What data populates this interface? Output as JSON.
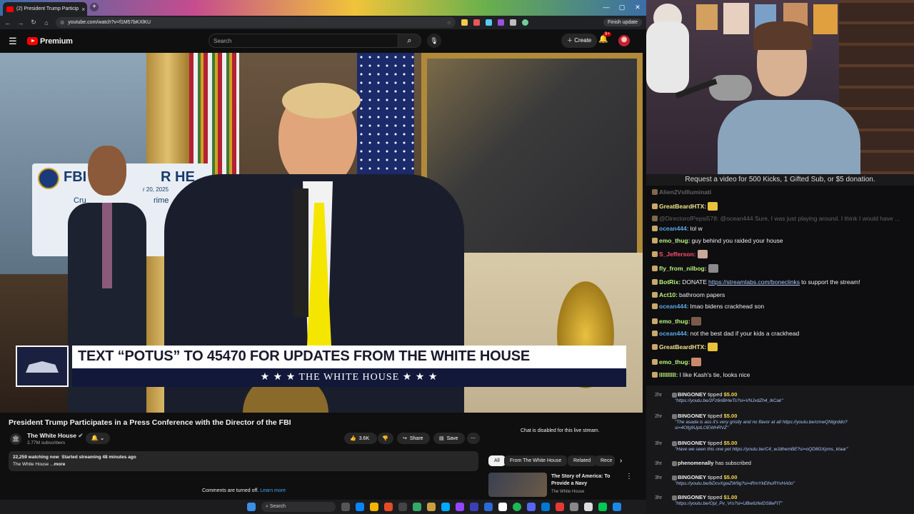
{
  "browser": {
    "tab_title": "(2) President Trump Particip",
    "url": "youtube.com/watch?v=f1M57bKXlKU",
    "finish_update": "Finish update"
  },
  "youtube": {
    "brand": "Premium",
    "search_placeholder": "Search",
    "create_label": "Create",
    "notif_count": "9+"
  },
  "video": {
    "lower_third_main": "TEXT “POTUS” TO 45470 FOR UPDATES FROM THE WHITE HOUSE",
    "lower_third_sub": "★ ★ ★  THE WHITE HOUSE  ★ ★ ★",
    "banner_left": "FBI",
    "banner_right": "R HE",
    "banner_date": "r 20, 2025",
    "banner_line2": "Cru",
    "banner_line2b": "rime",
    "title": "President Trump Participates in a Press Conference with the Director of the FBI"
  },
  "channel": {
    "name": "The White House",
    "subs": "2.77M subscribers"
  },
  "actions": {
    "likes": "3.6K",
    "share": "Share",
    "save": "Save"
  },
  "description": {
    "watching": "22,259 watching now",
    "started": "Started streaming 48 minutes ago",
    "line2": "The White House ...",
    "more": "more"
  },
  "comments": {
    "off": "Comments are turned off.",
    "learn": "Learn more"
  },
  "sidebar": {
    "chat_disabled": "Chat is disabled for this live stream.",
    "chips": [
      "All",
      "From The White House",
      "Related",
      "Rece"
    ],
    "rec_title": "The Story of America: To Provide a Navy",
    "rec_channel": "The White House"
  },
  "stream": {
    "banner": "Request a video for 500 Kicks, 1 Gifted Sub, or $5 donation.",
    "chat": [
      {
        "user": "Alien2VsIlluminati",
        "text": "",
        "color": "#9a9a9a"
      },
      {
        "user": "GreatBeardHTX:",
        "text": "",
        "color": "#f0e68c",
        "emote": "#e8c23a"
      },
      {
        "user": "",
        "text": "@DirectorofPepsi578: @ocean444 Sure, I was just playing around. I think I would have ...",
        "color": "#9a9a9a"
      },
      {
        "user": "ocean444:",
        "text": "lol w",
        "color": "#5aa9e6"
      },
      {
        "user": "emo_thug:",
        "text": "guy behind you raided your house",
        "color": "#b9f27c"
      },
      {
        "user": "S_Jefferson:",
        "text": "",
        "color": "#ff4f6d",
        "emote": "#c9a89a"
      },
      {
        "user": "fly_from_nilbog:",
        "text": "",
        "color": "#b9f27c",
        "emote": "#8a8a8a"
      },
      {
        "user": "BotRix:",
        "text": "DONATE",
        "link": "https://streamlabs.com/boneclinks",
        "after": "to support the stream!",
        "color": "#b9f27c"
      },
      {
        "user": "Act10:",
        "text": "bathroom papers",
        "color": "#b9f27c"
      },
      {
        "user": "ocean444:",
        "text": "lmao bidens crackhead son",
        "color": "#5aa9e6"
      },
      {
        "user": "emo_thug:",
        "text": "",
        "color": "#b9f27c",
        "emote": "#7a5a4a"
      },
      {
        "user": "ocean444:",
        "text": "not the best dad if your kids a crackhead",
        "color": "#5aa9e6"
      },
      {
        "user": "GreatBeardHTX:",
        "text": "",
        "color": "#f0e68c",
        "emote": "#e8c23a"
      },
      {
        "user": "emo_thug:",
        "text": "",
        "color": "#b9f27c",
        "emote": "#c98a6a"
      },
      {
        "user": "llllllllll:",
        "text": "I like Kash's tie, looks nice",
        "color": "#b9f27c"
      }
    ],
    "tips": [
      {
        "time": "2hr",
        "name": "BINGONEY",
        "action": "tipped",
        "amount": "$5.00",
        "msg": "\"https://youtu.be/2Fz6nBHwTs?si=VNJvdZh4_lkCak\""
      },
      {
        "time": "2hr",
        "name": "BINGONEY",
        "action": "tipped",
        "amount": "$5.00",
        "msg": "\"The asada is ass it's very gristly and no flavor at all https://youtu.be/cmwQNlgrddo?",
        "msg2": "si=4Ofg9UptLOEWHRVZ\""
      },
      {
        "time": "3hr",
        "name": "BINGONEY",
        "action": "tipped",
        "amount": "$5.00",
        "msg": "\"Have we seen this one yet https://youtu.be/C4_wJdhemBE?si=oQD8GXpms_ktaar\""
      },
      {
        "time": "3hr",
        "name": "phenomenally",
        "action": "has subscribed",
        "amount": "",
        "msg": ""
      },
      {
        "time": "3hr",
        "name": "BINGONEY",
        "action": "tipped",
        "amount": "$5.00",
        "msg": "\"https://youtu.be/bDcvXgwZW9g?si=iRmYkElhuRYvHA0o\""
      },
      {
        "time": "3hr",
        "name": "BINGONEY",
        "action": "tipped",
        "amount": "$1.00",
        "msg": "\"https://youtu.be/Opl_Pv_Vrs?si=UBwIizfeIDS8eFIT\""
      }
    ]
  },
  "taskbar": {
    "search": "Search"
  }
}
